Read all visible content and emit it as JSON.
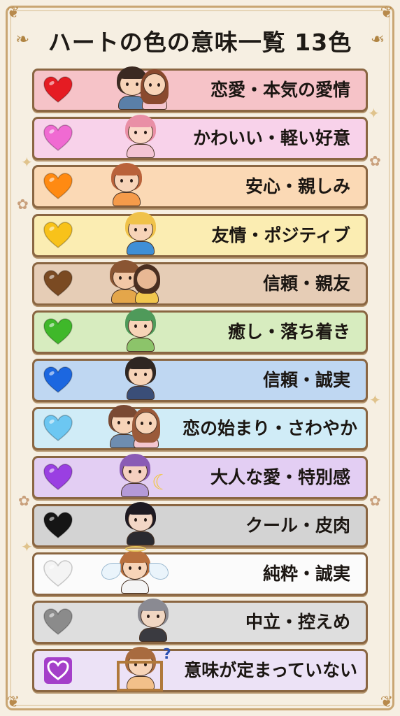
{
  "title": "ハートの色の意味一覧 13色",
  "rows": [
    {
      "label": "恋愛・本気の愛情",
      "heart_color": "#e51c23",
      "row_color": "#f6c3c8",
      "icon": "red-heart-icon"
    },
    {
      "label": "かわいい・軽い好意",
      "heart_color": "#f06ad2",
      "row_color": "#f8d2ea",
      "icon": "pink-heart-icon"
    },
    {
      "label": "安心・親しみ",
      "heart_color": "#ff8a12",
      "row_color": "#fbd9b5",
      "icon": "orange-heart-icon"
    },
    {
      "label": "友情・ポジティブ",
      "heart_color": "#f8c21a",
      "row_color": "#fbedb2",
      "icon": "yellow-heart-icon"
    },
    {
      "label": "信頼・親友",
      "heart_color": "#7a4a22",
      "row_color": "#e6cdb6",
      "icon": "brown-heart-icon"
    },
    {
      "label": "癒し・落ち着き",
      "heart_color": "#3fb82a",
      "row_color": "#d7ecbf",
      "icon": "green-heart-icon"
    },
    {
      "label": "信頼・誠実",
      "heart_color": "#1c67e0",
      "row_color": "#bfd7f2",
      "icon": "blue-heart-icon"
    },
    {
      "label": "恋の始まり・さわやか",
      "heart_color": "#6cc7f2",
      "row_color": "#d0ecf7",
      "icon": "light-blue-heart-icon"
    },
    {
      "label": "大人な愛・特別感",
      "heart_color": "#9a3fe2",
      "row_color": "#e3cef3",
      "icon": "purple-heart-icon"
    },
    {
      "label": "クール・皮肉",
      "heart_color": "#151515",
      "row_color": "#d3d3d3",
      "icon": "black-heart-icon"
    },
    {
      "label": "純粋・誠実",
      "heart_color": "#f4f4f4",
      "row_color": "#fbfbfb",
      "icon": "white-heart-icon"
    },
    {
      "label": "中立・控えめ",
      "heart_color": "#8b8b8b",
      "row_color": "#dedede",
      "icon": "grey-heart-icon"
    },
    {
      "label": "意味が定まっていない",
      "heart_color": "#e8c8f6",
      "row_color": "#ece2f6",
      "icon": "heart-decoration-icon"
    }
  ]
}
